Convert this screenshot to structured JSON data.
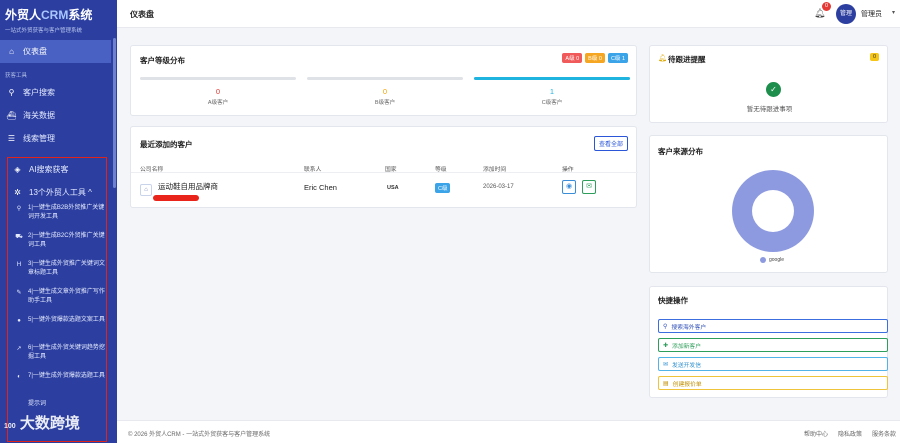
{
  "brand": {
    "name_prefix": "外贸人",
    "name_accent": "CRM",
    "name_suffix": "系统",
    "subtitle": "一站式外贸获客与客户管理系统"
  },
  "sidebar": {
    "dashboard": "仪表盘",
    "section_label": "获客工具",
    "items": [
      {
        "label": "客户搜索",
        "icon": "search-icon"
      },
      {
        "label": "海关数据",
        "icon": "ship-icon"
      },
      {
        "label": "线索管理",
        "icon": "list-icon"
      },
      {
        "label": "AI搜索获客",
        "icon": "ai-icon"
      },
      {
        "label": "13个外贸人工具 ^",
        "icon": "tools-icon"
      }
    ],
    "tools": [
      "1|一键生成B2B外贸推广关键词开发工具",
      "2|一键生成B2C外贸推广关键词工具",
      "3|一键生成外贸推广关键词文章标题工具",
      "4|一键生成文章外贸推广写作助手工具",
      "5|一键外贸爆款选题文案工具",
      "6|一键生成外贸关键词趋势挖掘工具",
      "7|一键生成外贸爆款选题工具",
      "提示词"
    ]
  },
  "topbar": {
    "title": "仪表盘",
    "notification_count": "0",
    "avatar_text": "管理",
    "username": "管理员"
  },
  "grade_card": {
    "title": "客户等级分布",
    "badges": [
      {
        "label": "A级 0",
        "color": "#f05a5a"
      },
      {
        "label": "B级 0",
        "color": "#f5a623"
      },
      {
        "label": "C级 1",
        "color": "#3ba3e8"
      }
    ],
    "grades": [
      {
        "count": "0",
        "label": "A级客户",
        "fill": 0,
        "color": "#e53935"
      },
      {
        "count": "0",
        "label": "B级客户",
        "fill": 0,
        "color": "#f0a500"
      },
      {
        "count": "1",
        "label": "C级客户",
        "fill": 1,
        "color": "#1fb3e0"
      }
    ]
  },
  "recent": {
    "title": "最近添加的客户",
    "view_all": "查看全部",
    "headers": [
      "公司名称",
      "联系人",
      "国家",
      "等级",
      "添加时间",
      "操作"
    ],
    "rows": [
      {
        "company": "运动鞋自用品牌商",
        "contact": "Eric Chen",
        "country": "USA",
        "grade": "C级",
        "date": "2026-03-17"
      }
    ]
  },
  "followup": {
    "title": "待跟进提醒",
    "badge": "0",
    "empty_text": "暂无待跟进事项"
  },
  "source": {
    "title": "客户来源分布",
    "legend": "google"
  },
  "chart_data": {
    "type": "pie",
    "categories": [
      "google"
    ],
    "values": [
      1
    ],
    "title": "客户来源分布"
  },
  "quick": {
    "title": "快捷操作",
    "actions": [
      "搜索海外客户",
      "添加新客户",
      "发送开发信",
      "创建报价单"
    ]
  },
  "footer": {
    "copyright": "© 2026 外贸人CRM - 一站式外贸获客与客户管理系统",
    "links": [
      "帮助中心",
      "隐私政策",
      "服务条款"
    ]
  },
  "watermark": {
    "text": "大数跨境",
    "small": "100"
  },
  "colors": {
    "sidebar": "#2c3fa0",
    "accent": "#2c56d8",
    "red_highlight": "#e2231a"
  }
}
